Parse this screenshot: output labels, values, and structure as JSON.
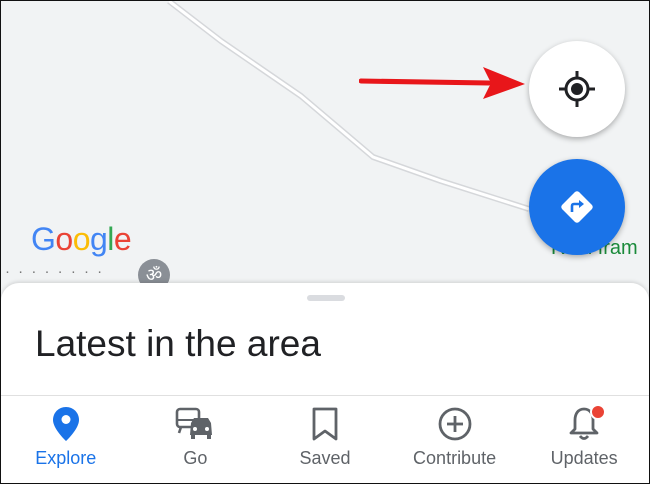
{
  "map": {
    "logo_letters": [
      "G",
      "o",
      "o",
      "g",
      "l",
      "e"
    ],
    "logo_colors": [
      "#4285f4",
      "#ea4335",
      "#fbbc05",
      "#4285f4",
      "#34a853",
      "#ea4335"
    ],
    "place_label": "Real fram",
    "poi_label": "· · · · · · · ·",
    "poi_icon_glyph": "ॐ"
  },
  "buttons": {
    "my_location_icon": "my-location-icon",
    "directions_icon": "directions-icon",
    "directions_color": "#1a73e8"
  },
  "sheet": {
    "title": "Latest in the area"
  },
  "nav": {
    "active_color": "#1a73e8",
    "items": [
      {
        "label": "Explore",
        "icon": "location-pin-icon"
      },
      {
        "label": "Go",
        "icon": "commute-icon"
      },
      {
        "label": "Saved",
        "icon": "bookmark-icon"
      },
      {
        "label": "Contribute",
        "icon": "add-circle-icon"
      },
      {
        "label": "Updates",
        "icon": "bell-icon"
      }
    ]
  }
}
